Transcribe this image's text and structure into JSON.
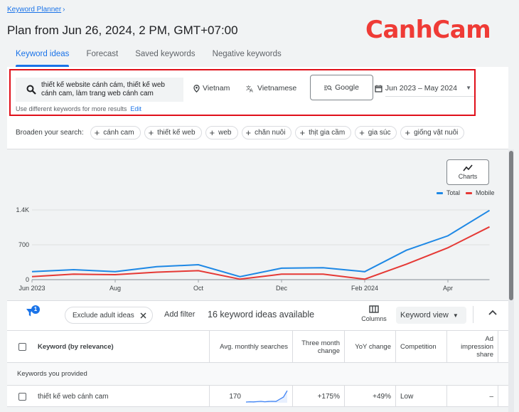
{
  "breadcrumb": {
    "label": "Keyword Planner",
    "chevron": "›"
  },
  "page_title": "Plan from Jun 26, 2024, 2 PM, GMT+07:00",
  "brand": {
    "logo_text": "CanhCam",
    "color": "#ef3b36"
  },
  "tabs": [
    {
      "label": "Keyword ideas",
      "active": true
    },
    {
      "label": "Forecast",
      "active": false
    },
    {
      "label": "Saved keywords",
      "active": false
    },
    {
      "label": "Negative keywords",
      "active": false
    }
  ],
  "search": {
    "icon": "search-icon",
    "value_line1": "thiết kế website cánh cám, thiết kế web",
    "value_line2": "cánh cam, làm trang web cánh cam",
    "hint": "Use different keywords for more results",
    "edit_label": "Edit"
  },
  "targeting": {
    "location": "Vietnam",
    "language": "Vietnamese",
    "network": "Google",
    "date_range": "Jun 2023 – May 2024"
  },
  "broaden": {
    "label": "Broaden your search:",
    "chips": [
      "cánh cam",
      "thiết kế web",
      "web",
      "chăn nuôi",
      "thịt gia cầm",
      "gia súc",
      "giống vật nuôi"
    ]
  },
  "chart_controls": {
    "charts_label": "Charts"
  },
  "chart_data": {
    "type": "line",
    "title": "",
    "xlabel": "",
    "ylabel": "",
    "x": [
      "Jun 2023",
      "Jul",
      "Aug",
      "Sep",
      "Oct",
      "Nov",
      "Dec",
      "Jan",
      "Feb 2024",
      "Mar",
      "Apr",
      "May"
    ],
    "x_tick_labels": [
      "Jun 2023",
      "Aug",
      "Oct",
      "Dec",
      "Feb 2024",
      "Apr"
    ],
    "y_ticks": [
      0,
      700,
      1400
    ],
    "y_tick_labels": [
      "0",
      "700",
      "1.4K"
    ],
    "ylim": [
      0,
      1400
    ],
    "grid": true,
    "legend_position": "top-right",
    "series": [
      {
        "name": "Total",
        "color": "#1e88e5",
        "values": [
          160,
          200,
          160,
          260,
          300,
          60,
          230,
          240,
          160,
          590,
          880,
          1390
        ]
      },
      {
        "name": "Mobile",
        "color": "#e53935",
        "values": [
          60,
          110,
          100,
          150,
          180,
          10,
          110,
          110,
          10,
          310,
          640,
          1060
        ]
      }
    ]
  },
  "toolbar": {
    "filter_badge": "1",
    "exclude_chip": "Exclude adult ideas",
    "add_filter": "Add filter",
    "ideas_count": "16 keyword ideas available",
    "columns_label": "Columns",
    "view_label": "Keyword view"
  },
  "table": {
    "columns": [
      "Keyword (by relevance)",
      "Avg. monthly searches",
      "Three month change",
      "YoY change",
      "Competition",
      "Ad impression share"
    ],
    "groups": [
      {
        "label": "Keywords you provided",
        "rows": [
          {
            "keyword": "thiết kế web cánh cam",
            "avg_monthly": "170",
            "trend": [
              20,
              22,
              21,
              23,
              25,
              22,
              24,
              25,
              24,
              40,
              55,
              100
            ],
            "three_month": "+175%",
            "yoy": "+49%",
            "competition": "Low",
            "ad_impression_share": "–"
          }
        ]
      }
    ]
  }
}
